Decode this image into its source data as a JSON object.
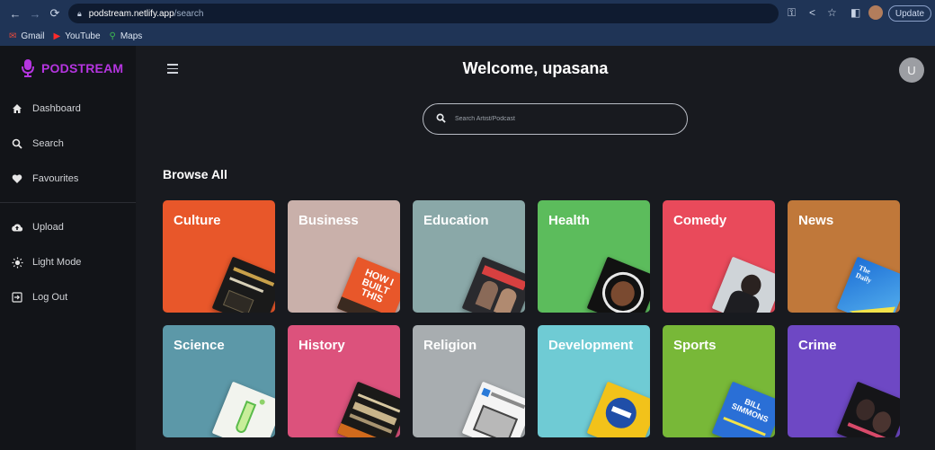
{
  "browser": {
    "url_host": "podstream.netlify.app",
    "url_path": "/search",
    "update_label": "Update",
    "bookmarks": [
      {
        "label": "Gmail",
        "icon": "gmail-icon"
      },
      {
        "label": "YouTube",
        "icon": "youtube-icon"
      },
      {
        "label": "Maps",
        "icon": "maps-icon"
      }
    ]
  },
  "app": {
    "logo_text": "PODSTREAM",
    "welcome": "Welcome, upasana",
    "avatar_initial": "U",
    "search_placeholder": "Search Artist/Podcast",
    "browse_title": "Browse All",
    "accent": "#b535e0"
  },
  "sidebar": {
    "items": [
      {
        "label": "Dashboard",
        "icon": "home-icon"
      },
      {
        "label": "Search",
        "icon": "search-icon"
      },
      {
        "label": "Favourites",
        "icon": "heart-icon"
      },
      {
        "label": "Upload",
        "icon": "cloud-upload-icon"
      },
      {
        "label": "Light Mode",
        "icon": "sun-icon"
      },
      {
        "label": "Log Out",
        "icon": "logout-icon"
      }
    ]
  },
  "categories": [
    {
      "name": "Culture",
      "color": "#e8572a"
    },
    {
      "name": "Business",
      "color": "#c9b0aa"
    },
    {
      "name": "Education",
      "color": "#8aa8a8"
    },
    {
      "name": "Health",
      "color": "#5cbc5c"
    },
    {
      "name": "Comedy",
      "color": "#e94a5b"
    },
    {
      "name": "News",
      "color": "#c0783a"
    },
    {
      "name": "Science",
      "color": "#5c98a8"
    },
    {
      "name": "History",
      "color": "#dc527c"
    },
    {
      "name": "Religion",
      "color": "#a8adb0"
    },
    {
      "name": "Development",
      "color": "#6fcbd4"
    },
    {
      "name": "Sports",
      "color": "#78b838"
    },
    {
      "name": "Crime",
      "color": "#6e48c4"
    }
  ],
  "cover_text": {
    "business": "HOW I BUILT THIS",
    "news": "The Daily",
    "sports": "BILL SIMMONS"
  }
}
